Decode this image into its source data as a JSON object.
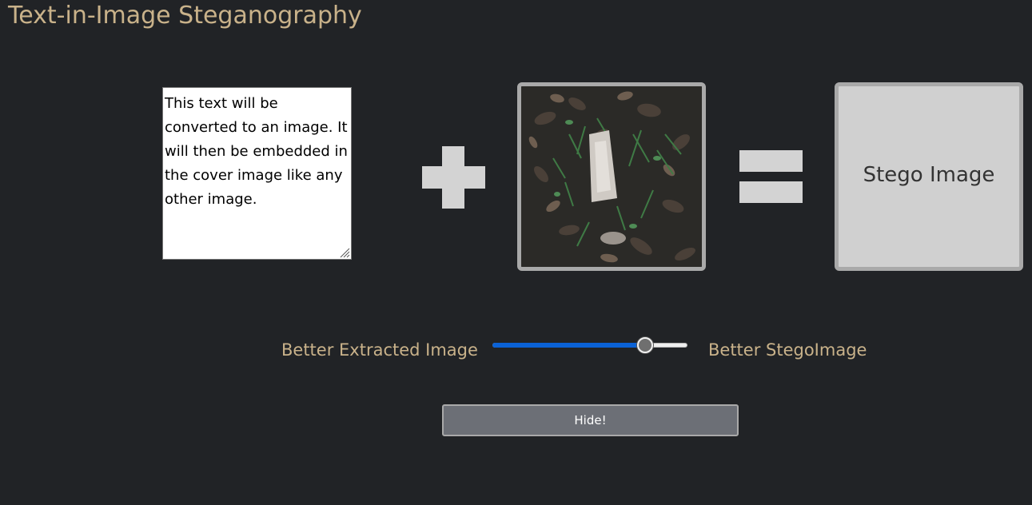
{
  "page": {
    "title": "Text-in-Image Steganography"
  },
  "secret_text": {
    "value": "This text will be converted to an image. It will then be embedded in the cover image like any other image."
  },
  "operators": {
    "plus_icon": "plus-icon",
    "equals_icon": "equals-icon"
  },
  "cover_image": {
    "description_icon": "cover-image-photo"
  },
  "stego_image": {
    "label": "Stego Image"
  },
  "quality_slider": {
    "left_label": "Better Extracted Image",
    "right_label": "Better StegoImage",
    "value": 0.81
  },
  "actions": {
    "hide_label": "Hide!"
  },
  "colors": {
    "background": "#212326",
    "accent_text": "#c9b28a",
    "slider_fill": "#0b62d6",
    "panel_gray": "#d0d0d0"
  }
}
